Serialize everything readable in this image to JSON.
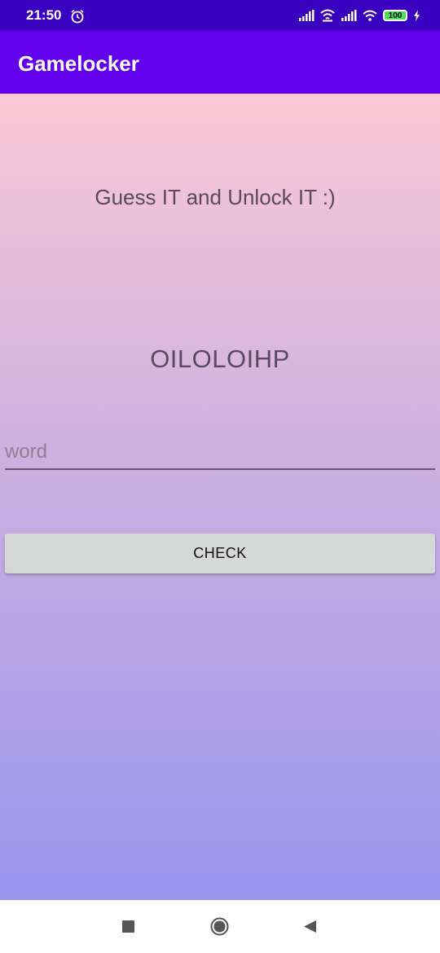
{
  "status_bar": {
    "time": "21:50",
    "battery": "100",
    "icons": [
      "alarm-icon",
      "signal-icon",
      "wifi-icon",
      "signal-icon",
      "wifi-icon",
      "battery-icon",
      "charging-icon"
    ]
  },
  "app_bar": {
    "title": "Gamelocker",
    "color": "#6200ee"
  },
  "main": {
    "subtitle": "Guess IT and Unlock IT :)",
    "scrambled_word": "OILOLOIHP",
    "word_input": {
      "placeholder": "word",
      "value": ""
    },
    "check_button_label": "CHECK"
  },
  "nav_bar": {
    "icons": [
      "recent-apps-icon",
      "home-icon",
      "back-icon"
    ]
  }
}
